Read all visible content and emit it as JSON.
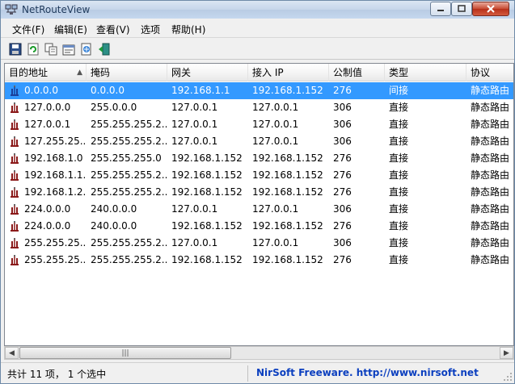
{
  "window": {
    "title": "NetRouteView"
  },
  "menu": [
    {
      "label": "文件(F)"
    },
    {
      "label": "编辑(E)"
    },
    {
      "label": "查看(V)"
    },
    {
      "label": "选项"
    },
    {
      "label": "帮助(H)"
    }
  ],
  "toolbar": {
    "icons": [
      "save-icon",
      "refresh-icon",
      "copy-icon",
      "properties-icon",
      "report-icon",
      "exit-icon"
    ]
  },
  "table": {
    "columns": [
      {
        "label": "目的地址",
        "sorted": true
      },
      {
        "label": "掩码"
      },
      {
        "label": "网关"
      },
      {
        "label": "接入 IP"
      },
      {
        "label": "公制值"
      },
      {
        "label": "类型"
      },
      {
        "label": "协议"
      }
    ],
    "rows": [
      {
        "dest": "0.0.0.0",
        "mask": "0.0.0.0",
        "gateway": "192.168.1.1",
        "iface": "192.168.1.152",
        "metric": "276",
        "type": "间接",
        "proto": "静态路由",
        "selected": true
      },
      {
        "dest": "127.0.0.0",
        "mask": "255.0.0.0",
        "gateway": "127.0.0.1",
        "iface": "127.0.0.1",
        "metric": "306",
        "type": "直接",
        "proto": "静态路由"
      },
      {
        "dest": "127.0.0.1",
        "mask": "255.255.255.2...",
        "gateway": "127.0.0.1",
        "iface": "127.0.0.1",
        "metric": "306",
        "type": "直接",
        "proto": "静态路由"
      },
      {
        "dest": "127.255.25...",
        "mask": "255.255.255.2...",
        "gateway": "127.0.0.1",
        "iface": "127.0.0.1",
        "metric": "306",
        "type": "直接",
        "proto": "静态路由"
      },
      {
        "dest": "192.168.1.0",
        "mask": "255.255.255.0",
        "gateway": "192.168.1.152",
        "iface": "192.168.1.152",
        "metric": "276",
        "type": "直接",
        "proto": "静态路由"
      },
      {
        "dest": "192.168.1.1...",
        "mask": "255.255.255.2...",
        "gateway": "192.168.1.152",
        "iface": "192.168.1.152",
        "metric": "276",
        "type": "直接",
        "proto": "静态路由"
      },
      {
        "dest": "192.168.1.2...",
        "mask": "255.255.255.2...",
        "gateway": "192.168.1.152",
        "iface": "192.168.1.152",
        "metric": "276",
        "type": "直接",
        "proto": "静态路由"
      },
      {
        "dest": "224.0.0.0",
        "mask": "240.0.0.0",
        "gateway": "127.0.0.1",
        "iface": "127.0.0.1",
        "metric": "306",
        "type": "直接",
        "proto": "静态路由"
      },
      {
        "dest": "224.0.0.0",
        "mask": "240.0.0.0",
        "gateway": "192.168.1.152",
        "iface": "192.168.1.152",
        "metric": "276",
        "type": "直接",
        "proto": "静态路由"
      },
      {
        "dest": "255.255.25...",
        "mask": "255.255.255.2...",
        "gateway": "127.0.0.1",
        "iface": "127.0.0.1",
        "metric": "306",
        "type": "直接",
        "proto": "静态路由"
      },
      {
        "dest": "255.255.25...",
        "mask": "255.255.255.2...",
        "gateway": "192.168.1.152",
        "iface": "192.168.1.152",
        "metric": "276",
        "type": "直接",
        "proto": "静态路由"
      }
    ]
  },
  "status": {
    "summary": "共计 11 项， 1 个选中",
    "link": "NirSoft Freeware.  http://www.nirsoft.net"
  },
  "colors": {
    "selection": "#3399ff",
    "link": "#0b3fbf"
  }
}
